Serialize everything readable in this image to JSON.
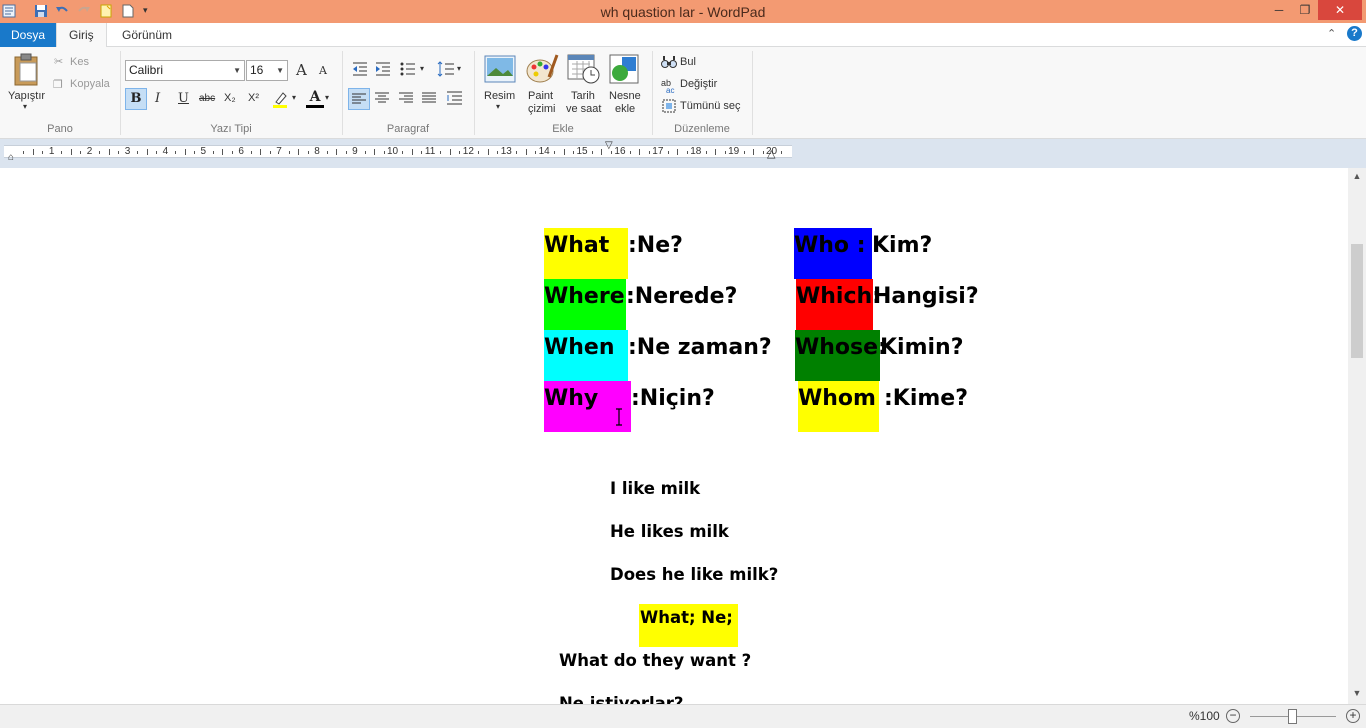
{
  "window": {
    "title": "wh quastion lar - WordPad",
    "minimize": "─",
    "maximize": "❐",
    "close": "✕"
  },
  "tabs": [
    {
      "label": "Dosya"
    },
    {
      "label": "Giriş"
    },
    {
      "label": "Görünüm"
    }
  ],
  "ribbon": {
    "clipboard": {
      "group": "Pano",
      "paste": "Yapıştır",
      "cut": "Kes",
      "copy": "Kopyala"
    },
    "font": {
      "group": "Yazı Tipi",
      "family": "Calibri",
      "size": "16",
      "bold": "B",
      "italic": "I",
      "underline": "U",
      "strike": "abc",
      "subscript": "X₂",
      "superscript": "X²",
      "grow": "A",
      "shrink": "A",
      "color_letter": "A"
    },
    "paragraph": {
      "group": "Paragraf"
    },
    "insert": {
      "group": "Ekle",
      "picture": "Resim",
      "paint_line1": "Paint",
      "paint_line2": "çizimi",
      "datetime_line1": "Tarih",
      "datetime_line2": "ve saat",
      "object_line1": "Nesne",
      "object_line2": "ekle"
    },
    "editing": {
      "group": "Düzenleme",
      "find": "Bul",
      "replace": "Değiştir",
      "select_all": "Tümünü seç"
    }
  },
  "ruler": {
    "numbers": [
      "1",
      "2",
      "3",
      "4",
      "5",
      "6",
      "7",
      "8",
      "9",
      "10",
      "11",
      "12",
      "13",
      "14",
      "15",
      "16",
      "17",
      "18",
      "19",
      "20"
    ]
  },
  "document": {
    "left_words": [
      {
        "en": "What",
        "tr": ":Ne?",
        "color": "#ffff00"
      },
      {
        "en": "Where",
        "tr": ":Nerede?",
        "color": "#00ff00"
      },
      {
        "en": "When",
        "tr": ":Ne zaman?",
        "color": "#00ffff"
      },
      {
        "en": "Why",
        "tr": ":Niçin?",
        "color": "#ff00ff"
      }
    ],
    "right_words": [
      {
        "en": "Who  :",
        "tr": "Kim?",
        "color": "#0000ff"
      },
      {
        "en": "Which:",
        "tr": "Hangisi?",
        "color": "#ff0000"
      },
      {
        "en": "Whose:",
        "tr": "Kimin?",
        "color": "#008000"
      },
      {
        "en": "Whom",
        "tr": ":Kime?",
        "color": "#ffff00"
      }
    ],
    "line1": "I like milk",
    "line2": "He likes milk",
    "line3": "Does he like milk?",
    "line4": "What;  Ne;",
    "line4_color": "#ffff00",
    "line5": "What do they want ?",
    "line6": "Ne istiyorlar?"
  },
  "statusbar": {
    "zoom": "%100",
    "zoom_out": "−",
    "zoom_in": "+"
  },
  "colors": {
    "titlebar": "#f39a72",
    "file_tab": "#1979ca",
    "close_button": "#d9473d"
  }
}
